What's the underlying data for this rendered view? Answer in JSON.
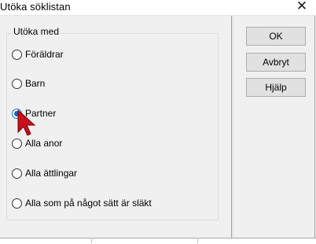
{
  "window": {
    "title": "Utöka söklistan",
    "close_glyph": "✕"
  },
  "group": {
    "label": "Utöka med",
    "options": [
      {
        "label": "Föräldrar",
        "checked": false
      },
      {
        "label": "Barn",
        "checked": false
      },
      {
        "label": "Partner",
        "checked": true
      },
      {
        "label": "Alla anor",
        "checked": false
      },
      {
        "label": "Alla ättlingar",
        "checked": false
      },
      {
        "label": "Alla som på något sätt är släkt",
        "checked": false
      }
    ]
  },
  "buttons": {
    "ok": "OK",
    "cancel": "Avbryt",
    "help": "Hjälp"
  },
  "colors": {
    "radio_selected": "#1e63c4",
    "cursor": "#c8101b"
  },
  "icons": {
    "close": "close-icon",
    "cursor": "mouse-pointer-icon"
  }
}
